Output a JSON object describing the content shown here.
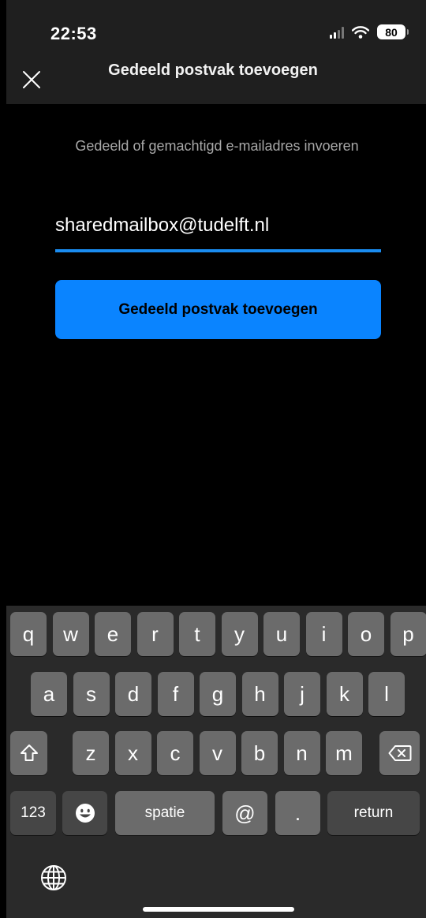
{
  "status_bar": {
    "time": "22:53",
    "battery": "80"
  },
  "header": {
    "title": "Gedeeld postvak toevoegen"
  },
  "main": {
    "prompt": "Gedeeld of gemachtigd e-mailadres invoeren",
    "email_value": "sharedmailbox@tudelft.nl",
    "button_label": "Gedeeld postvak toevoegen"
  },
  "keyboard": {
    "row1": [
      "q",
      "w",
      "e",
      "r",
      "t",
      "y",
      "u",
      "i",
      "o",
      "p"
    ],
    "row2": [
      "a",
      "s",
      "d",
      "f",
      "g",
      "h",
      "j",
      "k",
      "l"
    ],
    "row3": [
      "z",
      "x",
      "c",
      "v",
      "b",
      "n",
      "m"
    ],
    "numbers_label": "123",
    "space_label": "spatie",
    "at_label": "@",
    "dot_label": ".",
    "return_label": "return",
    "icons": [
      "shift-icon",
      "backspace-icon",
      "emoji-icon",
      "globe-icon"
    ]
  },
  "colors": {
    "accent": "#0a84ff",
    "underline": "#1a8cf0",
    "header_bg": "#1f1f1f",
    "keyboard_bg": "#2a2a2a"
  }
}
